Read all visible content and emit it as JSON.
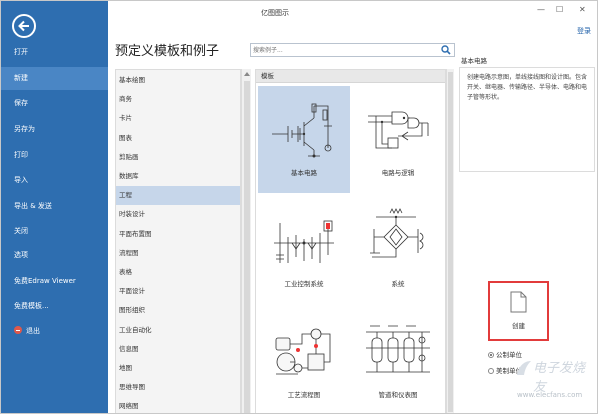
{
  "window": {
    "title": "亿图图示",
    "minimize": "—",
    "restore": "☐",
    "close": "✕",
    "login": "登录"
  },
  "sidebar": {
    "items": [
      {
        "label": "打开"
      },
      {
        "label": "新建"
      },
      {
        "label": "保存"
      },
      {
        "label": "另存为"
      },
      {
        "label": "打印"
      },
      {
        "label": "导入"
      },
      {
        "label": "导出 & 发送"
      },
      {
        "label": "关闭"
      },
      {
        "label": "选项"
      },
      {
        "label": "免费Edraw Viewer"
      },
      {
        "label": "免费模板..."
      },
      {
        "label": "退出"
      }
    ],
    "active_index": 1
  },
  "main": {
    "heading": "预定义模板和例子",
    "search_placeholder": "搜索例子..."
  },
  "categories": [
    "基本绘图",
    "商务",
    "卡片",
    "图表",
    "剪贴画",
    "数据库",
    "工程",
    "时装设计",
    "平面布置图",
    "流程图",
    "表格",
    "平面设计",
    "图形组织",
    "工业自动化",
    "信息图",
    "地图",
    "思维导图",
    "网络图"
  ],
  "selected_category": "工程",
  "templates": {
    "header": "模板",
    "items": [
      {
        "label": "基本电路",
        "selected": true
      },
      {
        "label": "电路与逻辑",
        "selected": false
      },
      {
        "label": "工业控制系统",
        "selected": false
      },
      {
        "label": "系统",
        "selected": false
      },
      {
        "label": "工艺流程图",
        "selected": false
      },
      {
        "label": "管道和仪表图",
        "selected": false
      }
    ]
  },
  "detail": {
    "title": "基本电路",
    "description": "创建电路示意图，单线接线图和设计图。包含开关、继电器、传输路径、半导体、电路和电子管等形状。",
    "create_label": "创建",
    "units": [
      {
        "label": "公制单位",
        "checked": true
      },
      {
        "label": "美制单位",
        "checked": false
      }
    ]
  },
  "watermark": {
    "text": "电子发烧友",
    "url": "www.elecfans.com"
  },
  "colors": {
    "sidebar": "#2e6eb0",
    "sidebar_active": "#4a86c5",
    "selected": "#c6d6ea",
    "create_border": "#e23b3b",
    "link": "#1e5fa8"
  }
}
